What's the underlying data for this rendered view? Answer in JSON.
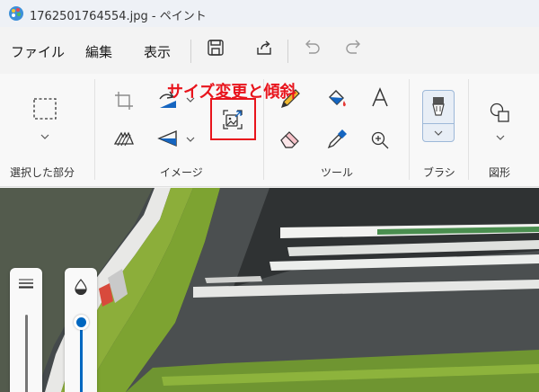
{
  "window": {
    "title": "1762501764554.jpg - ペイント"
  },
  "menu": {
    "file": "ファイル",
    "edit": "編集",
    "view": "表示"
  },
  "ribbon": {
    "groups": {
      "selection": "選択した部分",
      "image": "イメージ",
      "tools": "ツール",
      "brushes": "ブラシ",
      "shapes": "図形"
    }
  },
  "annotation": {
    "text": "サイズ変更と傾斜",
    "color": "#e8141c"
  },
  "colors": {
    "accent": "#0067c0",
    "titlebar": "#eef1f6",
    "ribbon": "#f8f8f8"
  }
}
